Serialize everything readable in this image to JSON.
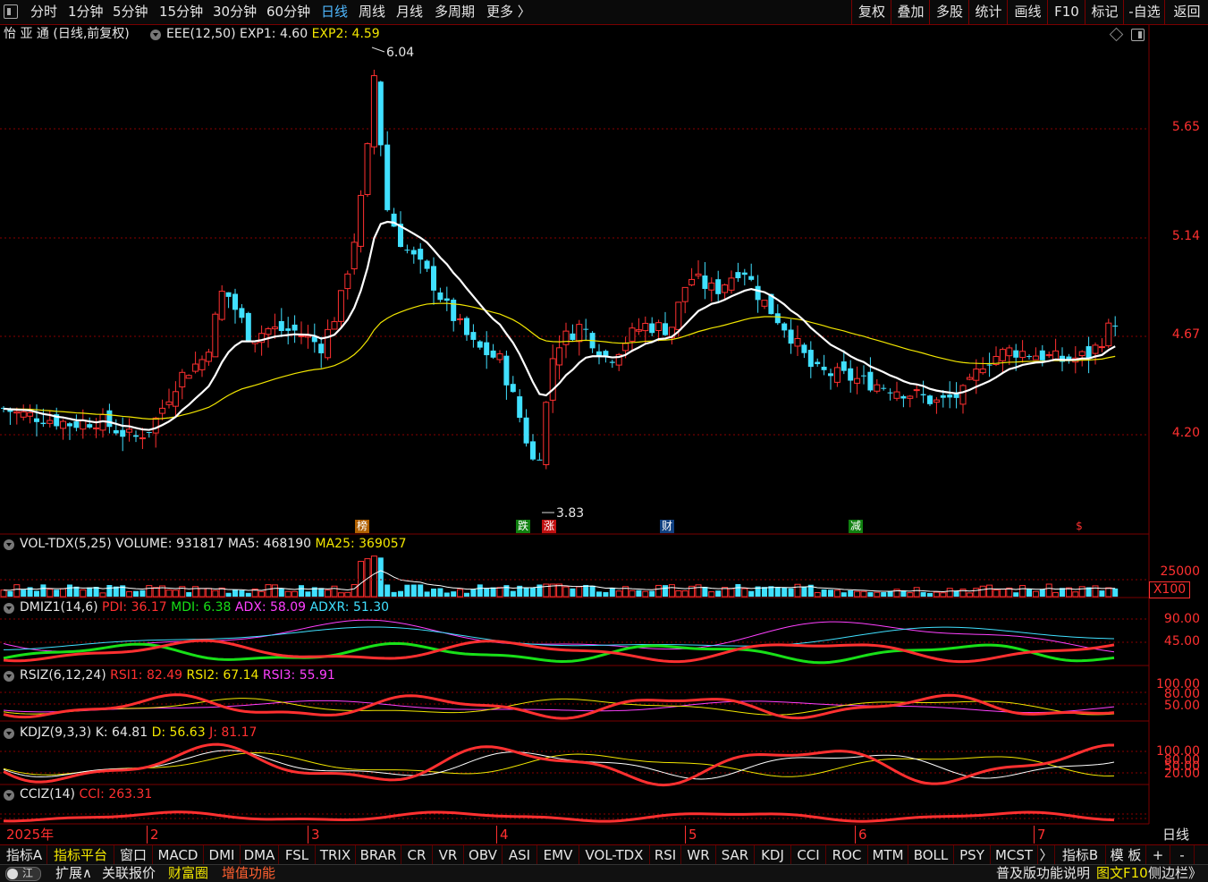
{
  "toolbar": {
    "left": [
      {
        "id": "fenshi",
        "label": "分时"
      },
      {
        "id": "1min",
        "label": "1分钟"
      },
      {
        "id": "5min",
        "label": "5分钟"
      },
      {
        "id": "15min",
        "label": "15分钟"
      },
      {
        "id": "30min",
        "label": "30分钟"
      },
      {
        "id": "60min",
        "label": "60分钟"
      },
      {
        "id": "daily",
        "label": "日线",
        "active": true
      },
      {
        "id": "weekly",
        "label": "周线"
      },
      {
        "id": "monthly",
        "label": "月线"
      },
      {
        "id": "multi",
        "label": "多周期"
      },
      {
        "id": "more",
        "label": "更多 〉"
      }
    ],
    "right": [
      {
        "id": "fuquan",
        "label": "复权"
      },
      {
        "id": "diejia",
        "label": "叠加"
      },
      {
        "id": "duogu",
        "label": "多股"
      },
      {
        "id": "tongji",
        "label": "统计"
      },
      {
        "id": "huaxian",
        "label": "画线"
      },
      {
        "id": "f10",
        "label": "F10"
      },
      {
        "id": "biaoji",
        "label": "标记"
      },
      {
        "id": "zixuan",
        "label": "-自选"
      },
      {
        "id": "fanhui",
        "label": "返回"
      }
    ]
  },
  "main": {
    "stock_name": "怡 亚 通",
    "mode": "(日线,前复权)",
    "indicator": "EEE(12,50)",
    "exp1_label": "EXP1: 4.60",
    "exp2_label": "EXP2: 4.59",
    "high_label": "6.04",
    "low_label": "3.83",
    "price_axis": [
      "5.65",
      "5.14",
      "4.67",
      "4.20"
    ],
    "tags": [
      "榜",
      "跌",
      "涨",
      "财",
      "减",
      "$"
    ]
  },
  "volume": {
    "title": "VOL-TDX(5,25)",
    "volume": "VOLUME: 931817",
    "ma5": "MA5: 468190",
    "ma25": "MA25: 369057",
    "axis_top": "25000",
    "unit": "X100"
  },
  "dmi": {
    "title": "DMIZ1(14,6)",
    "pdi": "PDI: 36.17",
    "mdi": "MDI: 6.38",
    "adx": "ADX: 58.09",
    "adxr": "ADXR: 51.30",
    "axis": [
      "90.00",
      "45.00"
    ]
  },
  "rsi": {
    "title": "RSIZ(6,12,24)",
    "rsi1": "RSI1: 82.49",
    "rsi2": "RSI2: 67.14",
    "rsi3": "RSI3: 55.91",
    "axis": [
      "100.00",
      "80.00",
      "50.00"
    ]
  },
  "kdj": {
    "title": "KDJZ(9,3,3)",
    "k": "K: 64.81",
    "d": "D: 56.63",
    "j": "J: 81.17",
    "axis": [
      "100.00",
      "80.00",
      "50.00",
      "20.00"
    ]
  },
  "cci": {
    "title": "CCIZ(14)",
    "cci": "CCI: 263.31"
  },
  "time_axis": [
    "2025年",
    "2",
    "3",
    "4",
    "5",
    "6",
    "7"
  ],
  "period_label": "日线",
  "tabs": [
    "指标A",
    "指标平台",
    "窗口",
    "MACD",
    "DMI",
    "DMA",
    "FSL",
    "TRIX",
    "BRAR",
    "CR",
    "VR",
    "OBV",
    "ASI",
    "EMV",
    "VOL-TDX",
    "RSI",
    "WR",
    "SAR",
    "KDJ",
    "CCI",
    "ROC",
    "MTM",
    "BOLL",
    "PSY",
    "MCST",
    "〉",
    "指标B",
    "模 板",
    "+",
    "-"
  ],
  "status": {
    "toggle_label": "江",
    "expand": "扩展∧",
    "related": "关联报价",
    "caifu": "财富圈",
    "zengzhi": "增值功能",
    "right_text1": "普及版功能说明",
    "right_text2": "图文F10",
    "right_text3": "侧边栏》"
  },
  "colors": {
    "up": "#ff3030",
    "down": "#40e0ff",
    "ma_white": "#ffffff",
    "ma_yellow": "#f2e600",
    "grid": "#7a0000"
  }
}
